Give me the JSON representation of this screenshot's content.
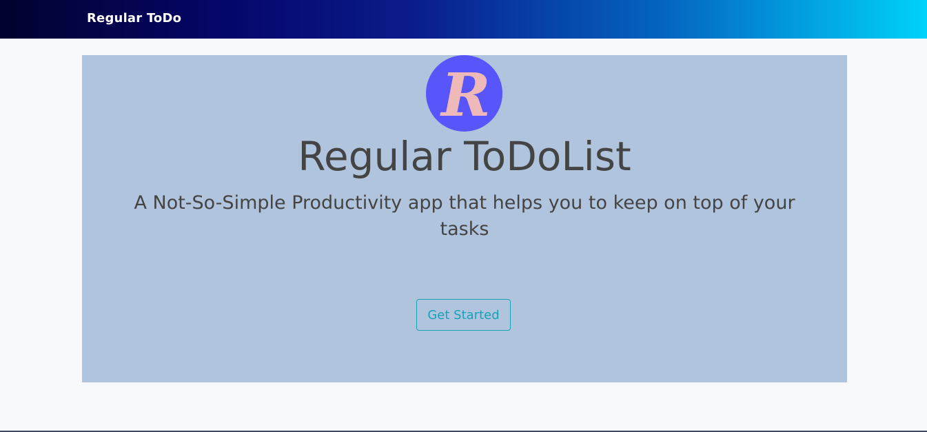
{
  "navbar": {
    "brand": "Regular ToDo",
    "gradient": [
      "#02022e",
      "#05066b",
      "#0a1d8c",
      "#0466c1",
      "#00d2fa"
    ]
  },
  "hero": {
    "logo_letter": "R",
    "logo_colors": {
      "circle": "#5856fb",
      "letter": "#efb9b9"
    },
    "title": "Regular ToDoList",
    "subtitle": "A Not-So-Simple Productivity app that helps you to keep on top of your tasks",
    "cta_label": "Get Started",
    "background": "#b0c4de",
    "cta_color": "#17a2b8"
  }
}
